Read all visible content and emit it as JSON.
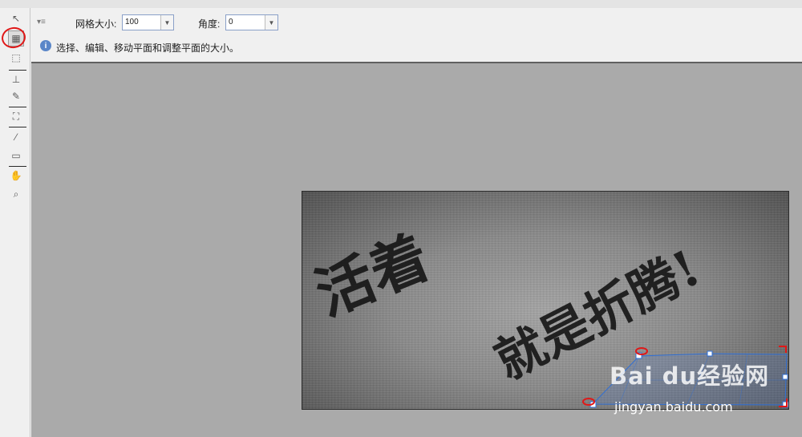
{
  "options": {
    "grid_size_label": "网格大小:",
    "grid_size_value": "100",
    "angle_label": "角度:",
    "angle_value": "0"
  },
  "hint": {
    "text": "选择、编辑、移动平面和调整平面的大小。"
  },
  "tools": [
    {
      "name": "select-icon",
      "glyph": "↖"
    },
    {
      "name": "edit-plane-icon",
      "glyph": "▦",
      "active": true
    },
    {
      "name": "create-plane-icon",
      "glyph": "⬚"
    },
    {
      "name": "stamp-icon",
      "glyph": "⊥"
    },
    {
      "name": "brush-icon",
      "glyph": "✎"
    },
    {
      "name": "transform-icon",
      "glyph": "⛶"
    },
    {
      "name": "eyedropper-icon",
      "glyph": "⁄"
    },
    {
      "name": "ruler-icon",
      "glyph": "▭"
    },
    {
      "name": "hand-icon",
      "glyph": "✋"
    },
    {
      "name": "zoom-icon",
      "glyph": "⌕"
    }
  ],
  "canvas": {
    "photo_text": [
      "活着",
      "就是折腾!"
    ]
  },
  "watermark": {
    "logo": "Bai du经验网",
    "url": "jingyan.baidu.com"
  },
  "colors": {
    "canvas_bg": "#aaaaaa",
    "panel_bg": "#f0f0f0",
    "annotation": "#e01818",
    "selection": "#2f6fd6"
  }
}
